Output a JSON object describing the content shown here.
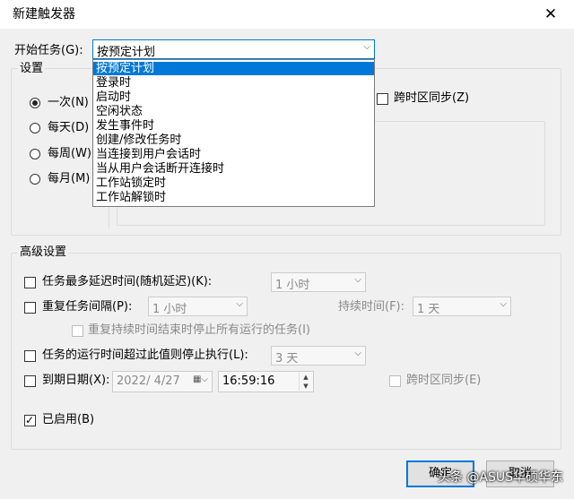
{
  "window": {
    "title": "新建触发器",
    "close_glyph": "✕"
  },
  "begin_task": {
    "label": "开始任务(G):",
    "value": "按预定计划",
    "options": [
      "按预定计划",
      "登录时",
      "启动时",
      "空闲状态",
      "发生事件时",
      "创建/修改任务时",
      "当连接到用户会话时",
      "当从用户会话断开连接时",
      "工作站锁定时",
      "工作站解锁时"
    ]
  },
  "settings": {
    "legend": "设置",
    "radios": [
      {
        "label": "一次(N)",
        "checked": true
      },
      {
        "label": "每天(D)",
        "checked": false
      },
      {
        "label": "每周(W)",
        "checked": false
      },
      {
        "label": "每月(M)",
        "checked": false
      }
    ],
    "sync_timezone": "跨时区同步(Z)"
  },
  "advanced": {
    "legend": "高级设置",
    "delay": {
      "label": "任务最多延迟时间(随机延迟)(K):",
      "value": "1 小时"
    },
    "repeat": {
      "label": "重复任务间隔(P):",
      "value": "1 小时",
      "duration_label": "持续时间(F):",
      "duration_value": "1 天"
    },
    "stop_all": {
      "label": "重复持续时间结束时停止所有运行的任务(I)"
    },
    "stop_after": {
      "label": "任务的运行时间超过此值则停止执行(L):",
      "value": "3 天"
    },
    "expire": {
      "label": "到期日期(X):",
      "date": "2022/ 4/27",
      "time": "16:59:16",
      "sync_label": "跨时区同步(E)"
    },
    "enabled": {
      "label": "已启用(B)",
      "checked": true
    }
  },
  "buttons": {
    "ok": "确定",
    "cancel": "取消"
  },
  "watermark": "头条 @ASUS华硕华东"
}
